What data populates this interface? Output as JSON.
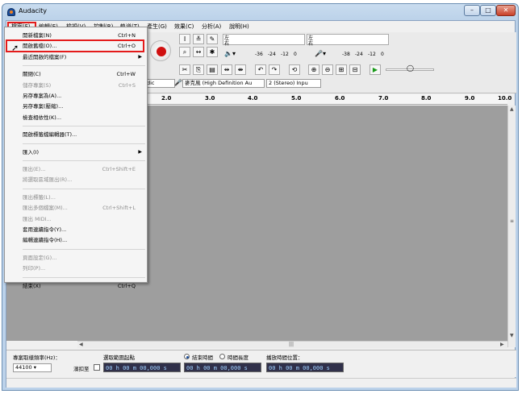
{
  "window": {
    "title": "Audacity",
    "min": "–",
    "max": "□",
    "close": "✕"
  },
  "menubar": [
    "檔案(F)",
    "編輯(E)",
    "檢視(V)",
    "控制(R)",
    "軌道(T)",
    "產生(G)",
    "效果(C)",
    "分析(A)",
    "說明(H)"
  ],
  "toolbar": {
    "meter_left": "左",
    "meter_right": "右",
    "meter_scale": [
      "-36",
      "-24",
      "-12",
      "0"
    ],
    "meter_scale_b": [
      "-38",
      "-24",
      "-12",
      "0"
    ],
    "mic_device": "麥克風 (High Definition Au",
    "channels": "2 (Stereo) Inpu",
    "host_partial": "dic"
  },
  "ruler": [
    "2.0",
    "3.0",
    "4.0",
    "5.0",
    "6.0",
    "7.0",
    "8.0",
    "9.0",
    "10.0"
  ],
  "file_menu": [
    {
      "label": "開新檔案(N)",
      "shortcut": "Ctrl+N",
      "disabled": false
    },
    {
      "label": "開啟舊檔(O)...",
      "shortcut": "Ctrl+O",
      "disabled": false
    },
    {
      "label": "最近開啟的檔案(F)",
      "shortcut": "",
      "disabled": false,
      "submenu": true
    },
    {
      "sep": true
    },
    {
      "label": "關閉(C)",
      "shortcut": "Ctrl+W",
      "disabled": false
    },
    {
      "label": "儲存專案(S)",
      "shortcut": "Ctrl+S",
      "disabled": true
    },
    {
      "label": "另存專案為(A)...",
      "shortcut": "",
      "disabled": false
    },
    {
      "label": "另存專案(壓縮)...",
      "shortcut": "",
      "disabled": false
    },
    {
      "label": "檢查相依性(K)...",
      "shortcut": "",
      "disabled": false
    },
    {
      "sep": true
    },
    {
      "label": "開啟標籤檔編輯器(T)...",
      "shortcut": "",
      "disabled": false
    },
    {
      "sep": true
    },
    {
      "label": "匯入(I)",
      "shortcut": "",
      "disabled": false,
      "submenu": true
    },
    {
      "sep": true
    },
    {
      "label": "匯出(E)...",
      "shortcut": "Ctrl+Shift+E",
      "disabled": true
    },
    {
      "label": "將選取區域匯出(R)...",
      "shortcut": "",
      "disabled": true
    },
    {
      "sep": true
    },
    {
      "label": "匯出標籤(L)...",
      "shortcut": "",
      "disabled": true
    },
    {
      "label": "匯出多個檔案(M)...",
      "shortcut": "Ctrl+Shift+L",
      "disabled": true
    },
    {
      "label": "匯出 MIDI...",
      "shortcut": "",
      "disabled": true
    },
    {
      "label": "套用連續指令(Y)...",
      "shortcut": "",
      "disabled": false
    },
    {
      "label": "編輯連續指令(H)...",
      "shortcut": "",
      "disabled": false
    },
    {
      "sep": true
    },
    {
      "label": "頁面設定(G)...",
      "shortcut": "",
      "disabled": true
    },
    {
      "label": "列印(P)...",
      "shortcut": "",
      "disabled": true
    },
    {
      "sep": true
    },
    {
      "label": "結束(X)",
      "shortcut": "Ctrl+Q",
      "disabled": false
    }
  ],
  "selection": {
    "rate_label": "專案取樣頻率(Hz)：",
    "rate_value": "44100",
    "snap_label": "濱扣至",
    "sel_label": "選取範圍起點",
    "end_radio": "結束時間",
    "len_radio": "時間長度",
    "pos_label": "播放時間位置：",
    "time_start": "00 h 00 m 00,000 s",
    "time_end": "00 h 00 m 00,000 s",
    "time_pos": "00 h 00 m 00,000 s"
  }
}
